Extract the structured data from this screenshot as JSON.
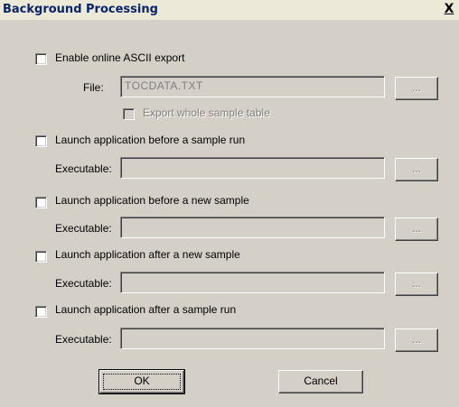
{
  "window": {
    "title": "Background Processing",
    "close_glyph": "X"
  },
  "ascii_export": {
    "checkbox_label": "Enable online ASCII export",
    "file_label": "File:",
    "file_value": "TOCDATA.TXT",
    "browse_label": "...",
    "export_table_label": "Export whole sample table"
  },
  "launch_sections": [
    {
      "checkbox_label": "Launch application before a sample run",
      "executable_label": "Executable:",
      "executable_value": "",
      "browse_label": "..."
    },
    {
      "checkbox_label": "Launch application before a new sample",
      "executable_label": "Executable:",
      "executable_value": "",
      "browse_label": "..."
    },
    {
      "checkbox_label": "Launch application after a new sample",
      "executable_label": "Executable:",
      "executable_value": "",
      "browse_label": "..."
    },
    {
      "checkbox_label": "Launch application after a sample run",
      "executable_label": "Executable:",
      "executable_value": "",
      "browse_label": "..."
    }
  ],
  "buttons": {
    "ok_label": "OK",
    "cancel_label": "Cancel"
  }
}
